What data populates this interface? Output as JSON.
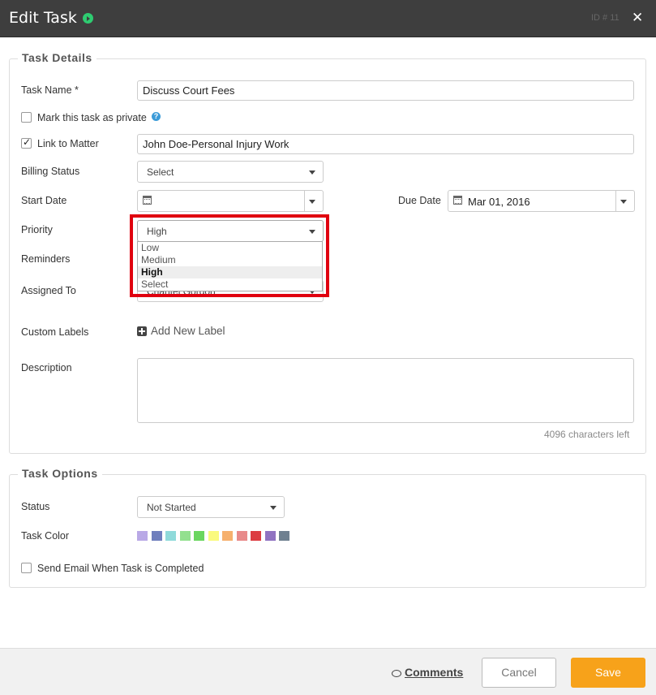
{
  "header": {
    "title": "Edit Task",
    "id_label": "ID # 11",
    "close_glyph": "✕",
    "status_icon": "play-circle-icon"
  },
  "task_details": {
    "legend": "Task Details",
    "task_name_label": "Task Name *",
    "task_name_value": "Discuss Court Fees",
    "private_label": "Mark this task as private",
    "private_checked": false,
    "help_glyph": "?",
    "link_label": "Link to Matter",
    "link_checked": true,
    "matter_value": "John Doe-Personal Injury Work",
    "billing_label": "Billing Status",
    "billing_value": "Select",
    "start_date_label": "Start Date",
    "start_date_value": "",
    "due_date_label": "Due Date",
    "due_date_value": "Mar 01, 2016",
    "priority_label": "Priority",
    "priority_value": "High",
    "priority_options": [
      "Low",
      "Medium",
      "High",
      "Select"
    ],
    "reminders_label": "Reminders",
    "assigned_label": "Assigned To",
    "assigned_value": "Chantel Gordon",
    "custom_labels_label": "Custom Labels",
    "add_label_text": "Add New Label",
    "description_label": "Description",
    "description_value": "",
    "chars_left": "4096 characters left"
  },
  "task_options": {
    "legend": "Task Options",
    "status_label": "Status",
    "status_value": "Not Started",
    "color_label": "Task Color",
    "colors": [
      "#b9a9e6",
      "#6f7fbd",
      "#8fdada",
      "#93e08f",
      "#6ad65f",
      "#fafa7e",
      "#f6b06d",
      "#e88a8a",
      "#dc3c42",
      "#8f72c1",
      "#6f8090"
    ],
    "email_label": "Send Email When Task is Completed",
    "email_checked": false
  },
  "footer": {
    "comments_label": "Comments",
    "cancel_label": "Cancel",
    "save_label": "Save"
  }
}
